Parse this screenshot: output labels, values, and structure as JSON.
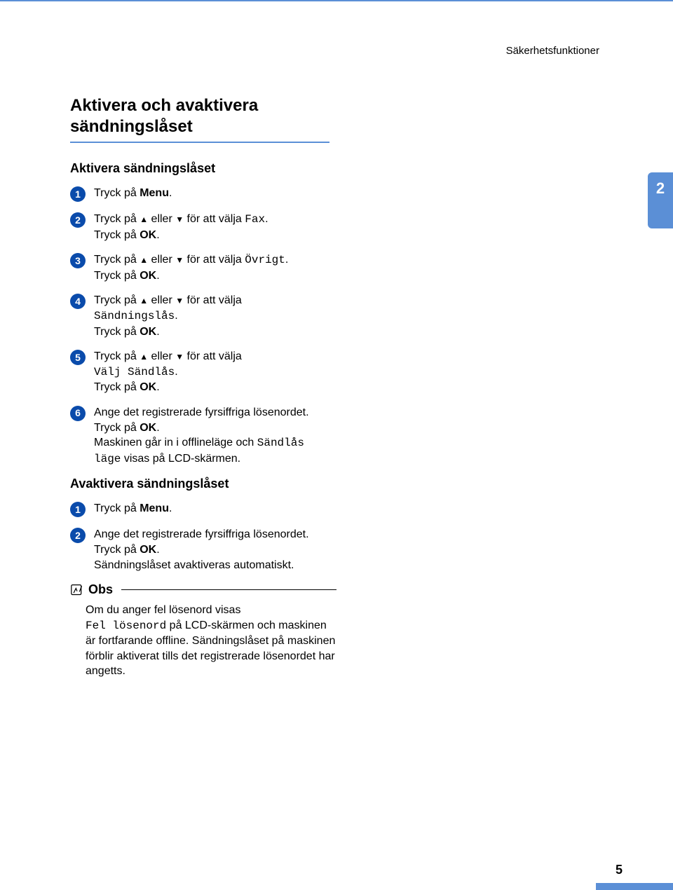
{
  "running_head": "Säkerhetsfunktioner",
  "chapter_tab": "2",
  "page_number": "5",
  "h1": "Aktivera och avaktivera sändningslåset",
  "sections": {
    "activate": {
      "title": "Aktivera sändningslåset",
      "steps": [
        {
          "num": "1",
          "parts": [
            {
              "t": "text",
              "v": "Tryck på "
            },
            {
              "t": "b",
              "v": "Menu"
            },
            {
              "t": "text",
              "v": "."
            }
          ]
        },
        {
          "num": "2",
          "parts": [
            {
              "t": "text",
              "v": "Tryck på "
            },
            {
              "t": "up",
              "v": "▲"
            },
            {
              "t": "text",
              "v": " eller "
            },
            {
              "t": "down",
              "v": "▼"
            },
            {
              "t": "text",
              "v": " för att välja "
            },
            {
              "t": "mono",
              "v": "Fax"
            },
            {
              "t": "text",
              "v": "."
            },
            {
              "t": "br"
            },
            {
              "t": "text",
              "v": "Tryck på "
            },
            {
              "t": "b",
              "v": "OK"
            },
            {
              "t": "text",
              "v": "."
            }
          ]
        },
        {
          "num": "3",
          "parts": [
            {
              "t": "text",
              "v": "Tryck på "
            },
            {
              "t": "up",
              "v": "▲"
            },
            {
              "t": "text",
              "v": " eller "
            },
            {
              "t": "down",
              "v": "▼"
            },
            {
              "t": "text",
              "v": " för att välja "
            },
            {
              "t": "mono",
              "v": "Övrigt"
            },
            {
              "t": "text",
              "v": "."
            },
            {
              "t": "br"
            },
            {
              "t": "text",
              "v": "Tryck på "
            },
            {
              "t": "b",
              "v": "OK"
            },
            {
              "t": "text",
              "v": "."
            }
          ]
        },
        {
          "num": "4",
          "parts": [
            {
              "t": "text",
              "v": "Tryck på "
            },
            {
              "t": "up",
              "v": "▲"
            },
            {
              "t": "text",
              "v": " eller "
            },
            {
              "t": "down",
              "v": "▼"
            },
            {
              "t": "text",
              "v": " för att välja "
            },
            {
              "t": "br"
            },
            {
              "t": "mono",
              "v": "Sändningslås"
            },
            {
              "t": "text",
              "v": "."
            },
            {
              "t": "br"
            },
            {
              "t": "text",
              "v": "Tryck på "
            },
            {
              "t": "b",
              "v": "OK"
            },
            {
              "t": "text",
              "v": "."
            }
          ]
        },
        {
          "num": "5",
          "parts": [
            {
              "t": "text",
              "v": "Tryck på "
            },
            {
              "t": "up",
              "v": "▲"
            },
            {
              "t": "text",
              "v": " eller "
            },
            {
              "t": "down",
              "v": "▼"
            },
            {
              "t": "text",
              "v": " för att välja "
            },
            {
              "t": "br"
            },
            {
              "t": "mono",
              "v": "Välj Sändlås"
            },
            {
              "t": "text",
              "v": "."
            },
            {
              "t": "br"
            },
            {
              "t": "text",
              "v": "Tryck på "
            },
            {
              "t": "b",
              "v": "OK"
            },
            {
              "t": "text",
              "v": "."
            }
          ]
        },
        {
          "num": "6",
          "parts": [
            {
              "t": "text",
              "v": "Ange det registrerade fyrsiffriga lösenordet."
            },
            {
              "t": "br"
            },
            {
              "t": "text",
              "v": "Tryck på "
            },
            {
              "t": "b",
              "v": "OK"
            },
            {
              "t": "text",
              "v": "."
            },
            {
              "t": "br"
            },
            {
              "t": "text",
              "v": "Maskinen går in i offlineläge och "
            },
            {
              "t": "mono",
              "v": "Sändlås läge"
            },
            {
              "t": "text",
              "v": " visas på LCD-skärmen."
            }
          ]
        }
      ]
    },
    "deactivate": {
      "title": "Avaktivera sändningslåset",
      "steps": [
        {
          "num": "1",
          "parts": [
            {
              "t": "text",
              "v": "Tryck på "
            },
            {
              "t": "b",
              "v": "Menu"
            },
            {
              "t": "text",
              "v": "."
            }
          ]
        },
        {
          "num": "2",
          "parts": [
            {
              "t": "text",
              "v": "Ange det registrerade fyrsiffriga lösenordet."
            },
            {
              "t": "br"
            },
            {
              "t": "text",
              "v": "Tryck på "
            },
            {
              "t": "b",
              "v": "OK"
            },
            {
              "t": "text",
              "v": "."
            },
            {
              "t": "br"
            },
            {
              "t": "text",
              "v": "Sändningslåset avaktiveras automatiskt."
            }
          ]
        }
      ]
    }
  },
  "note": {
    "title": "Obs",
    "body_parts": [
      {
        "t": "text",
        "v": "Om du anger fel lösenord visas "
      },
      {
        "t": "br"
      },
      {
        "t": "mono",
        "v": "Fel lösenord"
      },
      {
        "t": "text",
        "v": " på LCD-skärmen och maskinen är fortfarande offline. Sändningslåset på maskinen förblir aktiverat tills det registrerade lösenordet har angetts."
      }
    ]
  }
}
